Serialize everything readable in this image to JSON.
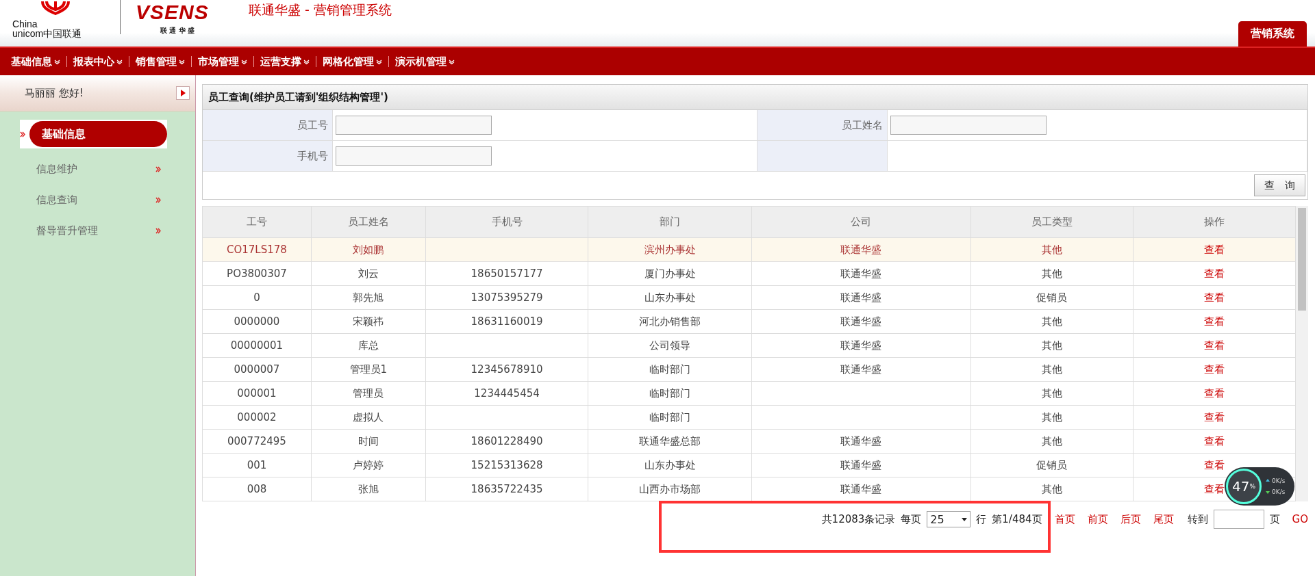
{
  "header": {
    "logo_line1": "China",
    "logo_line2": "unicom中国联通",
    "brand": "VSENS",
    "brand_sub": "联 通 华 盛",
    "title": "联通华盛 - 营销管理系统",
    "system_tab": {
      "label": "营销系统",
      "selected": true
    }
  },
  "nav": [
    "基础信息",
    "报表中心",
    "销售管理",
    "市场管理",
    "运营支撑",
    "网格化管理",
    "演示机管理"
  ],
  "sidebar": {
    "greeting": "马丽丽 您好!",
    "section": {
      "label": "基础信息",
      "selected": true
    },
    "items": [
      {
        "label": "信息维护",
        "selected": false
      },
      {
        "label": "信息查询",
        "selected": false
      },
      {
        "label": "督导晋升管理",
        "selected": false
      }
    ]
  },
  "panel": {
    "title": "员工查询(维护员工请到'组织结构管理')",
    "fields": [
      {
        "label": "员工号"
      },
      {
        "label": "员工姓名"
      },
      {
        "label": "手机号"
      }
    ],
    "search_button": "查　询"
  },
  "table": {
    "columns": [
      "工号",
      "员工姓名",
      "手机号",
      "部门",
      "公司",
      "员工类型",
      "操作"
    ],
    "rows": [
      {
        "selected": true,
        "cells": [
          "CO17LS178",
          "刘如鹏",
          "",
          "滨州办事处",
          "联通华盛",
          "其他",
          "查看"
        ]
      },
      {
        "selected": false,
        "cells": [
          "PO3800307",
          "刘云",
          "18650157177",
          "厦门办事处",
          "联通华盛",
          "其他",
          "查看"
        ]
      },
      {
        "selected": false,
        "cells": [
          "0",
          "郭先旭",
          "13075395279",
          "山东办事处",
          "联通华盛",
          "促销员",
          "查看"
        ]
      },
      {
        "selected": false,
        "cells": [
          "0000000",
          "宋颖祎",
          "18631160019",
          "河北办销售部",
          "联通华盛",
          "其他",
          "查看"
        ]
      },
      {
        "selected": false,
        "cells": [
          "00000001",
          "库总",
          "",
          "公司领导",
          "联通华盛",
          "其他",
          "查看"
        ]
      },
      {
        "selected": false,
        "cells": [
          "0000007",
          "管理员1",
          "12345678910",
          "临时部门",
          "联通华盛",
          "其他",
          "查看"
        ]
      },
      {
        "selected": false,
        "cells": [
          "000001",
          "管理员",
          "1234445454",
          "临时部门",
          "",
          "其他",
          "查看"
        ]
      },
      {
        "selected": false,
        "cells": [
          "000002",
          "虚拟人",
          "",
          "临时部门",
          "",
          "其他",
          "查看"
        ]
      },
      {
        "selected": false,
        "cells": [
          "000772495",
          "时间",
          "18601228490",
          "联通华盛总部",
          "联通华盛",
          "其他",
          "查看"
        ]
      },
      {
        "selected": false,
        "cells": [
          "001",
          "卢婷婷",
          "15215313628",
          "山东办事处",
          "联通华盛",
          "促销员",
          "查看"
        ]
      },
      {
        "selected": false,
        "cells": [
          "008",
          "张旭",
          "18635722435",
          "山西办市场部",
          "联通华盛",
          "其他",
          "查看"
        ]
      }
    ]
  },
  "pagination": {
    "total": "共12083条记录",
    "per_page_label": "每页",
    "per_page": "25",
    "rows_label": "行",
    "page": "第1/484页",
    "links": [
      "首页",
      "前页",
      "后页",
      "尾页"
    ],
    "goto_label": "转到",
    "page_suffix": "页",
    "go": "GO"
  },
  "speed_widget": {
    "percent": "47",
    "percent_sign": "%",
    "up": "0K/s",
    "down": "0K/s"
  }
}
